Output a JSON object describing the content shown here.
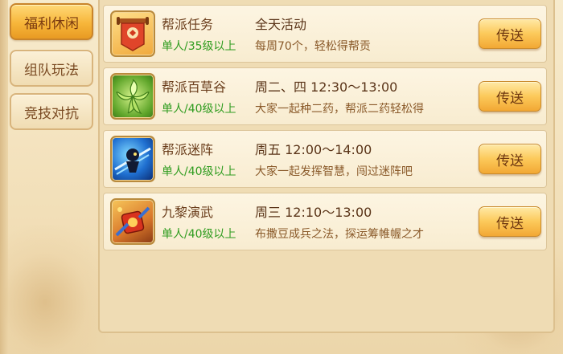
{
  "tabs": [
    {
      "label": "福利休闲",
      "active": true
    },
    {
      "label": "组队玩法",
      "active": false
    },
    {
      "label": "竞技对抗",
      "active": false
    }
  ],
  "activities": [
    {
      "name": "帮派任务",
      "level": "单人/35级以上",
      "time": "全天活动",
      "desc": "每周70个，轻松得帮贡",
      "button": "传送",
      "icon": "banner-scroll-icon"
    },
    {
      "name": "帮派百草谷",
      "level": "单人/40级以上",
      "time": "周二、四 12:30～13:00",
      "desc": "大家一起种二药，帮派二药轻松得",
      "button": "传送",
      "icon": "herb-leaf-icon"
    },
    {
      "name": "帮派迷阵",
      "level": "单人/40级以上",
      "time": "周五 12:00～14:00",
      "desc": "大家一起发挥智慧，闯过迷阵吧",
      "button": "传送",
      "icon": "maze-warrior-icon"
    },
    {
      "name": "九黎演武",
      "level": "单人/40级以上",
      "time": "周三 12:10～13:00",
      "desc": "布撒豆成兵之法，探运筹帷幄之才",
      "button": "传送",
      "icon": "war-drum-icon"
    }
  ],
  "colors": {
    "accent": "#f7b63a",
    "level_green": "#2f9c1f",
    "text_brown": "#6b3e1c"
  }
}
